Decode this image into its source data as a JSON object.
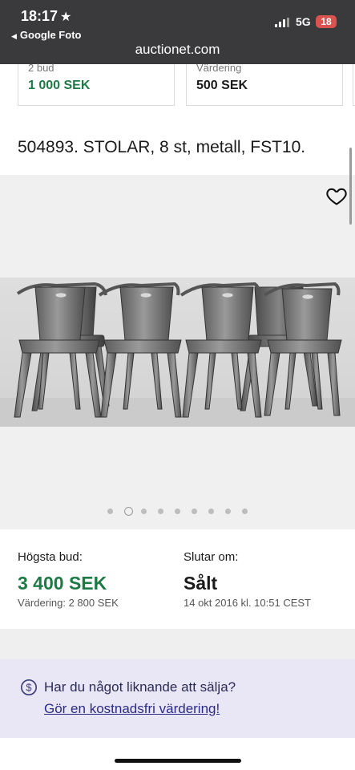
{
  "status": {
    "time": "18:17",
    "back_label": "Google Foto",
    "network": "5G",
    "battery": "18"
  },
  "browser": {
    "url": "auctionet.com"
  },
  "summary_cards": [
    {
      "label": "2 bud",
      "value": "1 000 SEK"
    },
    {
      "label": "Värdering",
      "value": "500 SEK"
    }
  ],
  "item": {
    "title": "504893. STOLAR, 8 st, metall, FST10."
  },
  "gallery": {
    "dot_count": 9,
    "active_index": 1
  },
  "bid": {
    "highest_label": "Högsta bud:",
    "highest_value": "3 400 SEK",
    "estimate": "Värdering: 2 800 SEK",
    "ends_label": "Slutar om:",
    "ends_value": "Sålt",
    "ends_date": "14 okt 2016 kl. 10:51 CEST"
  },
  "sell": {
    "question": "Har du något liknande att sälja?",
    "link": "Gör en kostnadsfri värdering!"
  },
  "colors": {
    "accent_green": "#1e7a45",
    "sell_bg": "#e9e6f6",
    "link": "#2b2b88"
  },
  "icons": [
    "star-icon",
    "back-arrow-icon",
    "signal-icon",
    "battery-icon",
    "heart-icon",
    "dollar-circle-icon"
  ]
}
